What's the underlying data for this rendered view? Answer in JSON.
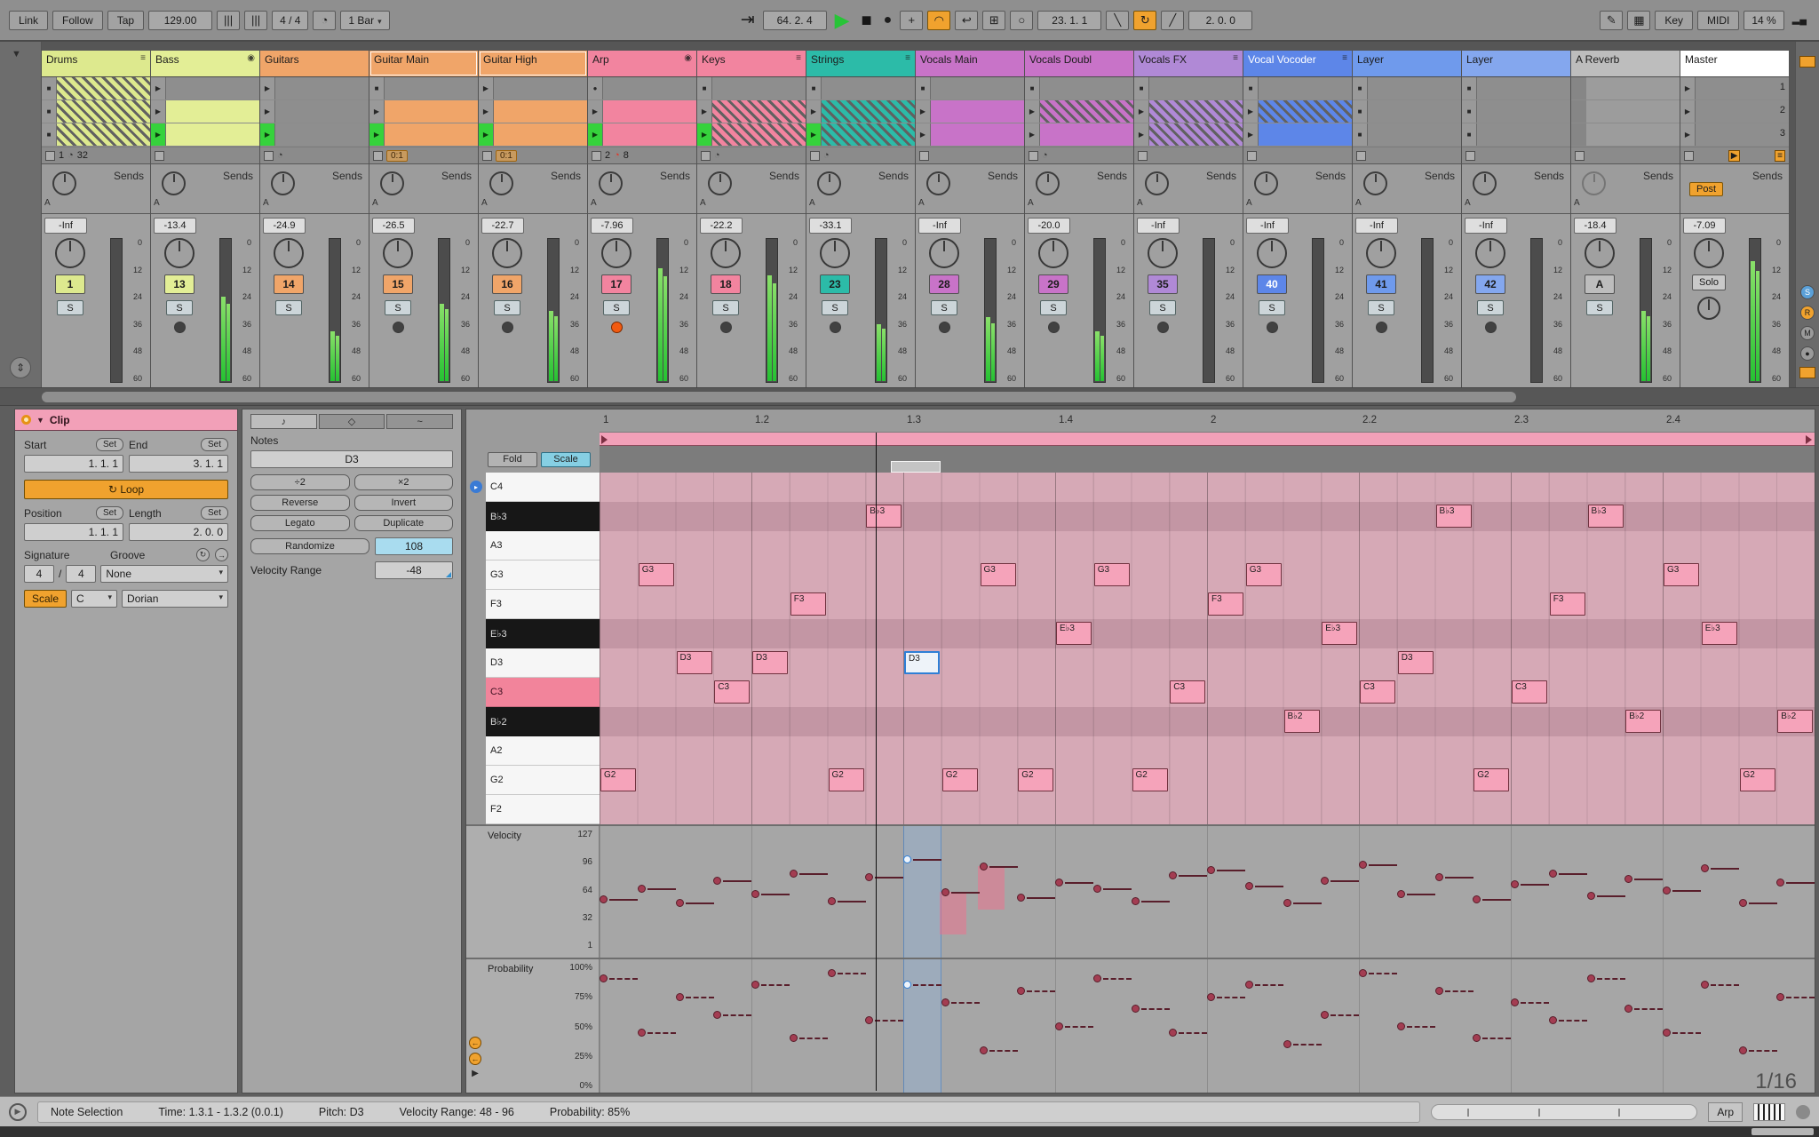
{
  "icons": {
    "menu": "≡",
    "collapse": "◉",
    "clock": "◔",
    "dropdown": "▾",
    "play": "▶",
    "stop": "■",
    "record": "●",
    "plus": "+",
    "loop": "↻",
    "pencil": "✎",
    "keyboard": "▦",
    "punch_in": "╲",
    "punch_out": "╱",
    "follow": "⇥",
    "automation": "◠",
    "reenable": "↩",
    "capture": "⊞",
    "session_rec": "○",
    "cpu_bars": "▂▄",
    "preview": "▸",
    "expander": "⇕",
    "triangle_down": "▼",
    "music_note": "♪",
    "tools": "◇",
    "envelope": "~",
    "nudge": "|||"
  },
  "transport": {
    "link": "Link",
    "follow": "Follow",
    "tap": "Tap",
    "tempo": "129.00",
    "sig": "4 / 4",
    "quantize": "1 Bar",
    "position": "64. 2. 4",
    "loop_start": "23. 1. 1",
    "loop_length": "2. 0. 0",
    "key": "Key",
    "midi": "MIDI",
    "cpu": "14 %"
  },
  "session": {
    "scenes": [
      "1",
      "2",
      "3"
    ],
    "meter_scale": [
      "0",
      "12",
      "24",
      "36",
      "48",
      "60"
    ],
    "sends_label": "Sends",
    "send_a": "A",
    "post_label": "Post",
    "solo_label": "Solo",
    "tracks": [
      {
        "name": "Drums",
        "color": "#dde98e",
        "icon": "menu",
        "slots": [
          [
            "stop",
            "hatched"
          ],
          [
            "stop",
            "hatched"
          ],
          [
            "stop",
            "hatched"
          ]
        ],
        "stop_row": {
          "left": "1",
          "clock": "gray",
          "right": "32"
        },
        "db": "-Inf",
        "num": "1",
        "level": 0,
        "arm": "none"
      },
      {
        "name": "Bass",
        "color": "#e3ee96",
        "icon": "collapse",
        "slots": [
          [
            "play",
            "none"
          ],
          [
            "play",
            "solid"
          ],
          [
            "playing",
            "solid"
          ]
        ],
        "stop_row": {},
        "db": "-13.4",
        "num": "13",
        "level": 0.6,
        "arm": "off"
      },
      {
        "name": "Guitars",
        "color": "#f0a569",
        "slots": [
          [
            "play",
            "none"
          ],
          [
            "play",
            "none"
          ],
          [
            "playing",
            "none"
          ]
        ],
        "stop_row": {
          "clock": "gray"
        },
        "db": "-24.9",
        "num": "14",
        "level": 0.35,
        "arm": "none"
      },
      {
        "name": "Guitar Main",
        "color": "#f0a569",
        "selected": true,
        "slots": [
          [
            "stop",
            "none"
          ],
          [
            "play",
            "solid"
          ],
          [
            "playing",
            "solid"
          ]
        ],
        "stop_row": {
          "box": "0:1"
        },
        "db": "-26.5",
        "num": "15",
        "level": 0.55,
        "arm": "off"
      },
      {
        "name": "Guitar High",
        "color": "#f0a569",
        "selected": true,
        "slots": [
          [
            "play",
            "none"
          ],
          [
            "play",
            "solid"
          ],
          [
            "playing",
            "solid"
          ]
        ],
        "stop_row": {
          "box": "0:1"
        },
        "db": "-22.7",
        "num": "16",
        "level": 0.5,
        "arm": "off"
      },
      {
        "name": "Arp",
        "color": "#f2849f",
        "icon": "collapse",
        "slots": [
          [
            "record",
            "none"
          ],
          [
            "play",
            "solid"
          ],
          [
            "playing",
            "solid"
          ]
        ],
        "stop_row": {
          "left": "2",
          "clock": "red",
          "right": "8"
        },
        "db": "-7.96",
        "num": "17",
        "level": 0.8,
        "arm": "on"
      },
      {
        "name": "Keys",
        "color": "#f2849f",
        "icon": "menu",
        "slots": [
          [
            "stop",
            "none"
          ],
          [
            "play",
            "hatched"
          ],
          [
            "playing",
            "hatched"
          ]
        ],
        "stop_row": {
          "clock": "gray"
        },
        "db": "-22.2",
        "num": "18",
        "level": 0.75,
        "arm": "off"
      },
      {
        "name": "Strings",
        "color": "#2cbba8",
        "icon": "menu",
        "slots": [
          [
            "stop",
            "none"
          ],
          [
            "play",
            "hatched"
          ],
          [
            "playing",
            "hatched"
          ]
        ],
        "stop_row": {
          "clock": "gray"
        },
        "db": "-33.1",
        "num": "23",
        "level": 0.4,
        "arm": "off"
      },
      {
        "name": "Vocals Main",
        "color": "#c873c8",
        "slots": [
          [
            "stop",
            "none"
          ],
          [
            "play",
            "solid"
          ],
          [
            "play",
            "solid"
          ]
        ],
        "stop_row": {},
        "db": "-Inf",
        "num": "28",
        "level": 0.45,
        "arm": "off"
      },
      {
        "name": "Vocals Doubl",
        "color": "#c873c8",
        "slots": [
          [
            "stop",
            "none"
          ],
          [
            "play",
            "hatched"
          ],
          [
            "play",
            "solid"
          ]
        ],
        "stop_row": {
          "clock": "gray"
        },
        "db": "-20.0",
        "num": "29",
        "level": 0.35,
        "arm": "off"
      },
      {
        "name": "Vocals FX",
        "color": "#b089d6",
        "icon": "menu",
        "slots": [
          [
            "stop",
            "none"
          ],
          [
            "play",
            "hatched"
          ],
          [
            "play",
            "hatched"
          ]
        ],
        "stop_row": {},
        "db": "-Inf",
        "num": "35",
        "level": 0,
        "arm": "off"
      },
      {
        "name": "Vocal Vocoder",
        "color": "#5d86e8",
        "icon": "menu",
        "text": "#ffffff",
        "slots": [
          [
            "stop",
            "none"
          ],
          [
            "play",
            "hatched"
          ],
          [
            "play",
            "solid"
          ]
        ],
        "stop_row": {},
        "db": "-Inf",
        "num": "40",
        "level": 0,
        "arm": "off"
      },
      {
        "name": "Layer",
        "color": "#6f9aec",
        "slots": [
          [
            "stop",
            "none"
          ],
          [
            "stop",
            "none"
          ],
          [
            "stop",
            "none"
          ]
        ],
        "stop_row": {},
        "db": "-Inf",
        "num": "41",
        "level": 0,
        "arm": "off"
      },
      {
        "name": "Layer",
        "color": "#84a7ee",
        "slots": [
          [
            "stop",
            "none"
          ],
          [
            "stop",
            "none"
          ],
          [
            "stop",
            "none"
          ]
        ],
        "stop_row": {},
        "db": "-Inf",
        "num": "42",
        "level": 0,
        "arm": "off"
      },
      {
        "name": "A Reverb",
        "color": "#bdbdbd",
        "return": true,
        "slots": [
          [
            "none",
            "blank"
          ],
          [
            "none",
            "blank"
          ],
          [
            "none",
            "blank"
          ]
        ],
        "stop_row": {},
        "db": "-18.4",
        "num": "A",
        "level": 0.5,
        "arm": "none"
      },
      {
        "name": "Master",
        "color": "#ffffff",
        "master": true,
        "slots": [
          [
            "play",
            "scene"
          ],
          [
            "play",
            "scene"
          ],
          [
            "play",
            "scene"
          ]
        ],
        "stop_row": {
          "master": true
        },
        "db": "-7.09",
        "num": "",
        "level": 0.85,
        "arm": "none"
      }
    ]
  },
  "clip_panel": {
    "title": "Clip",
    "start_label": "Start",
    "end_label": "End",
    "set_label": "Set",
    "start_value": "1. 1. 1",
    "end_value": "3. 1. 1",
    "loop_label": "Loop",
    "position_label": "Position",
    "length_label": "Length",
    "position_value": "1. 1. 1",
    "length_value": "2. 0. 0",
    "signature_label": "Signature",
    "groove_label": "Groove",
    "sig_num": "4",
    "sig_den": "4",
    "groove_value": "None",
    "scale_label": "Scale",
    "root": "C",
    "scale_name": "Dorian"
  },
  "notes_panel": {
    "title": "Notes",
    "pitch_display": "D3",
    "div2": "÷2",
    "mul2": "×2",
    "reverse": "Reverse",
    "invert": "Invert",
    "legato": "Legato",
    "duplicate": "Duplicate",
    "randomize": "Randomize",
    "randomize_value": "108",
    "velocity_range_label": "Velocity Range",
    "velocity_range_value": "-48"
  },
  "piano_roll": {
    "fold_label": "Fold",
    "scale_label": "Scale",
    "timeline": [
      "1",
      "1.2",
      "1.3",
      "1.4",
      "2",
      "2.2",
      "2.3",
      "2.4"
    ],
    "pitches": [
      {
        "label": "C4",
        "type": "white"
      },
      {
        "label": "B♭3",
        "type": "black"
      },
      {
        "label": "A3",
        "type": "white"
      },
      {
        "label": "G3",
        "type": "white"
      },
      {
        "label": "F3",
        "type": "white"
      },
      {
        "label": "E♭3",
        "type": "black"
      },
      {
        "label": "D3",
        "type": "white"
      },
      {
        "label": "C3",
        "type": "root"
      },
      {
        "label": "B♭2",
        "type": "black"
      },
      {
        "label": "A2",
        "type": "white"
      },
      {
        "label": "G2",
        "type": "white"
      },
      {
        "label": "F2",
        "type": "white"
      }
    ],
    "notes": [
      {
        "beat": 0,
        "pitch": "G2",
        "velocity": 52,
        "probability": 90
      },
      {
        "beat": 0.25,
        "pitch": "G3",
        "velocity": 64,
        "probability": 45
      },
      {
        "beat": 0.5,
        "pitch": "D3",
        "velocity": 48,
        "probability": 75
      },
      {
        "beat": 0.75,
        "pitch": "C3",
        "velocity": 72,
        "probability": 60
      },
      {
        "beat": 1,
        "pitch": "D3",
        "velocity": 58,
        "probability": 85
      },
      {
        "beat": 1.25,
        "pitch": "F3",
        "velocity": 80,
        "probability": 40
      },
      {
        "beat": 1.5,
        "pitch": "G2",
        "velocity": 50,
        "probability": 95
      },
      {
        "beat": 1.75,
        "pitch": "B♭3",
        "velocity": 76,
        "probability": 55
      },
      {
        "beat": 2,
        "pitch": "D3",
        "velocity": 96,
        "probability": 85,
        "selected": true
      },
      {
        "beat": 2.25,
        "pitch": "G2",
        "velocity": 60,
        "probability": 70,
        "range": true
      },
      {
        "beat": 2.5,
        "pitch": "G3",
        "velocity": 88,
        "probability": 30,
        "range": true
      },
      {
        "beat": 2.75,
        "pitch": "G2",
        "velocity": 54,
        "probability": 80
      },
      {
        "beat": 3,
        "pitch": "E♭3",
        "velocity": 70,
        "probability": 50
      },
      {
        "beat": 3.25,
        "pitch": "G3",
        "velocity": 64,
        "probability": 90
      },
      {
        "beat": 3.5,
        "pitch": "G2",
        "velocity": 50,
        "probability": 65
      },
      {
        "beat": 3.75,
        "pitch": "C3",
        "velocity": 78,
        "probability": 45
      },
      {
        "beat": 4,
        "pitch": "F3",
        "velocity": 84,
        "probability": 75
      },
      {
        "beat": 4.25,
        "pitch": "G3",
        "velocity": 66,
        "probability": 85
      },
      {
        "beat": 4.5,
        "pitch": "B♭2",
        "velocity": 48,
        "probability": 35
      },
      {
        "beat": 4.75,
        "pitch": "E♭3",
        "velocity": 72,
        "probability": 60
      },
      {
        "beat": 5,
        "pitch": "C3",
        "velocity": 90,
        "probability": 95
      },
      {
        "beat": 5.25,
        "pitch": "D3",
        "velocity": 58,
        "probability": 50
      },
      {
        "beat": 5.5,
        "pitch": "B♭3",
        "velocity": 76,
        "probability": 80
      },
      {
        "beat": 5.75,
        "pitch": "G2",
        "velocity": 52,
        "probability": 40
      },
      {
        "beat": 6,
        "pitch": "C3",
        "velocity": 68,
        "probability": 70
      },
      {
        "beat": 6.25,
        "pitch": "F3",
        "velocity": 80,
        "probability": 55
      },
      {
        "beat": 6.5,
        "pitch": "B♭3",
        "velocity": 56,
        "probability": 90
      },
      {
        "beat": 6.75,
        "pitch": "B♭2",
        "velocity": 74,
        "probability": 65
      },
      {
        "beat": 7,
        "pitch": "G3",
        "velocity": 62,
        "probability": 45
      },
      {
        "beat": 7.25,
        "pitch": "E♭3",
        "velocity": 86,
        "probability": 85
      },
      {
        "beat": 7.5,
        "pitch": "G2",
        "velocity": 48,
        "probability": 30
      },
      {
        "beat": 7.75,
        "pitch": "B♭2",
        "velocity": 70,
        "probability": 75
      }
    ]
  },
  "velocity_lane": {
    "label": "Velocity",
    "ticks": [
      "127",
      "96",
      "64",
      "32",
      "1"
    ]
  },
  "probability_lane": {
    "label": "Probability",
    "ticks": [
      "100%",
      "75%",
      "50%",
      "25%",
      "0%"
    ]
  },
  "status_bar": {
    "segments": [
      "Note Selection",
      "Time: 1.3.1 - 1.3.2 (0.0.1)",
      "Pitch: D3",
      "Velocity Range: 48 - 96",
      "Probability: 85%"
    ],
    "grid_value": "1/16",
    "device": "Arp"
  }
}
